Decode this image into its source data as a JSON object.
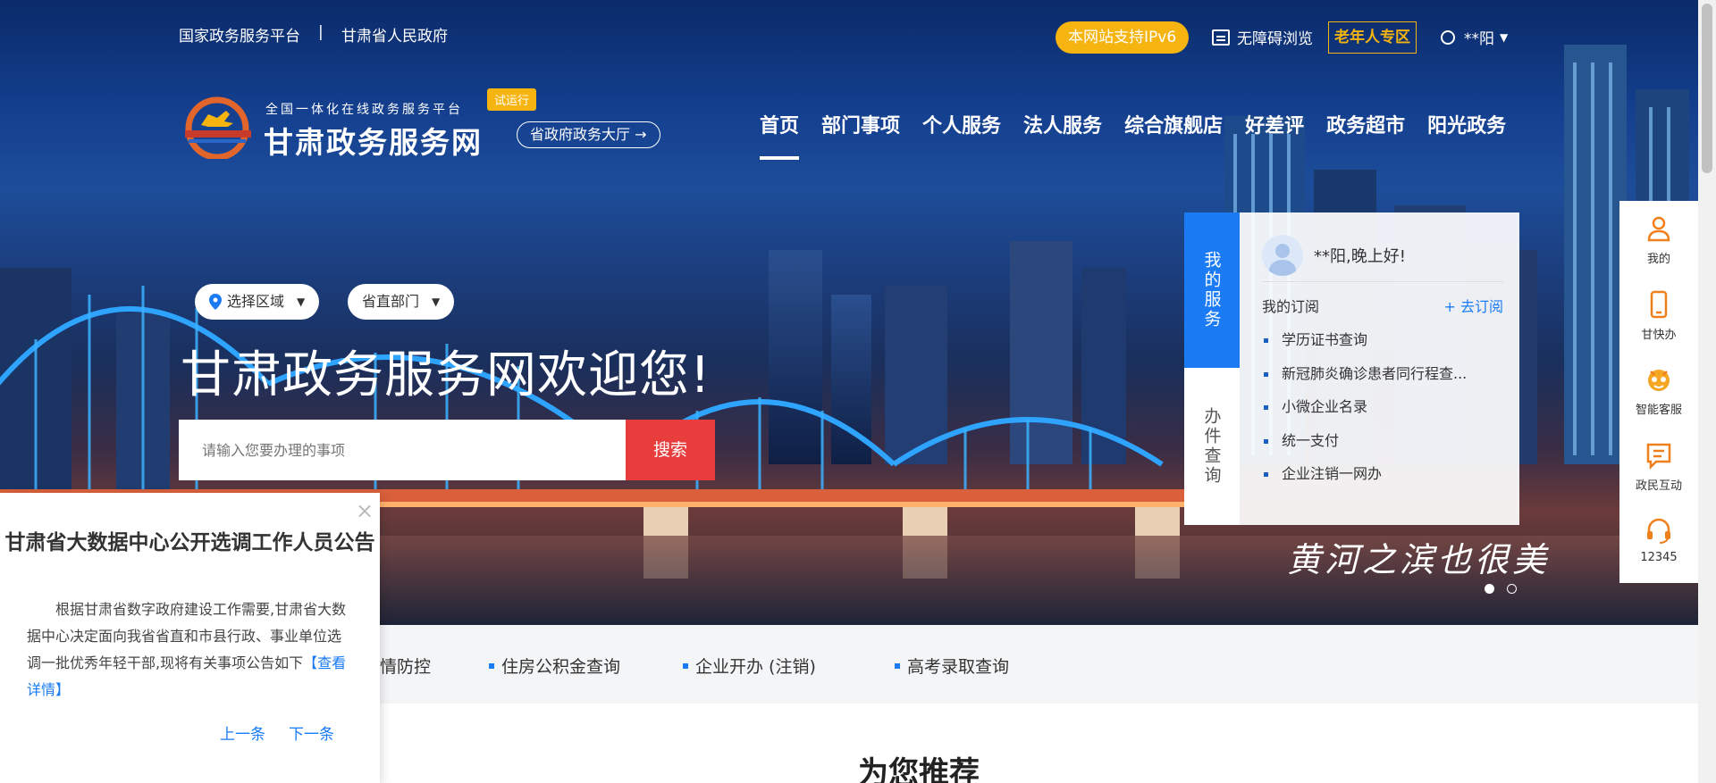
{
  "top": {
    "national_platform": "国家政务服务平台",
    "separator": "|",
    "provincial_gov": "甘肃省人民政府",
    "ipv6": "本网站支持IPv6",
    "accessibility": "无障碍浏览",
    "elder": "老年人专区",
    "user": "**阳"
  },
  "logo": {
    "subtitle": "全国一体化在线政务服务平台",
    "title": "甘肃政务服务网",
    "trial": "试运行",
    "hall_button": "省政府政务大厅 →"
  },
  "nav": [
    "首页",
    "部门事项",
    "个人服务",
    "法人服务",
    "综合旗舰店",
    "好差评",
    "政务超市",
    "阳光政务"
  ],
  "search": {
    "region": "选择区域",
    "department": "省直部门",
    "welcome": "甘肃政务服务网欢迎您!",
    "placeholder": "请输入您要办理的事项",
    "button": "搜索"
  },
  "banner": {
    "slogan": "黄河之滨也很美"
  },
  "panel": {
    "tab_my": "我的服务",
    "tab_query": "办件查询",
    "greeting": "**阳,晚上好!",
    "subscriptions_label": "我的订阅",
    "subscribe_link": "+ 去订阅",
    "items": [
      "学历证书查询",
      "新冠肺炎确诊患者同行程查...",
      "小微企业名录",
      "统一支付",
      "企业注销一网办"
    ]
  },
  "sidebar": [
    {
      "label": "我的",
      "icon": "person-icon"
    },
    {
      "label": "甘快办",
      "icon": "mobile-icon"
    },
    {
      "label": "智能客服",
      "icon": "robot-icon"
    },
    {
      "label": "政民互动",
      "icon": "chat-icon"
    },
    {
      "label": "12345",
      "icon": "headset-icon"
    }
  ],
  "quick_links": {
    "partial": "情防控",
    "items": [
      "住房公积金查询",
      "企业开办 (注销)",
      "高考录取查询"
    ]
  },
  "recommend_title": "为您推荐",
  "notice": {
    "close": "×",
    "title": "甘肃省大数据中心公开选调工作人员公告",
    "body": "根据甘肃省数字政府建设工作需要,甘肃省大数据中心决定面向我省省直和市县行政、事业单位选调一批优秀年轻干部,现将有关事项公告如下",
    "more": "【查看详情】",
    "prev": "上一条",
    "next": "下一条"
  },
  "colors": {
    "primary_blue": "#1a7bf5",
    "accent_yellow": "#f5b40f",
    "search_red": "#e83d3d"
  }
}
